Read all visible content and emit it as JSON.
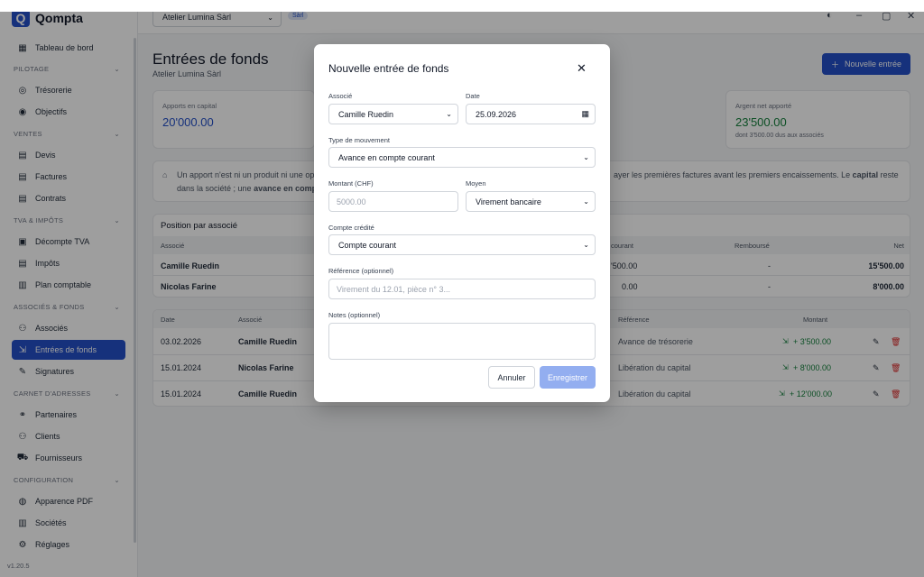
{
  "app": {
    "name": "Qompta",
    "version": "v1.20.5"
  },
  "sidebar": {
    "items": [
      {
        "label": "Tableau de bord",
        "icon": "dashboard-icon"
      },
      {
        "section": "PILOTAGE"
      },
      {
        "label": "Trésorerie",
        "icon": "coins-icon"
      },
      {
        "label": "Objectifs",
        "icon": "target-icon"
      },
      {
        "section": "VENTES"
      },
      {
        "label": "Devis",
        "icon": "document-icon"
      },
      {
        "label": "Factures",
        "icon": "invoice-icon"
      },
      {
        "label": "Contrats",
        "icon": "contract-icon"
      },
      {
        "section": "TVA & IMPÔTS"
      },
      {
        "label": "Décompte TVA",
        "icon": "tax-icon"
      },
      {
        "label": "Impôts",
        "icon": "receipt-icon"
      },
      {
        "label": "Plan comptable",
        "icon": "book-icon"
      },
      {
        "section": "ASSOCIÉS & FONDS"
      },
      {
        "label": "Associés",
        "icon": "users-icon"
      },
      {
        "label": "Entrées de fonds",
        "icon": "money-in-icon",
        "active": true
      },
      {
        "label": "Signatures",
        "icon": "pen-icon"
      },
      {
        "section": "CARNET D'ADRESSES"
      },
      {
        "label": "Partenaires",
        "icon": "handshake-icon"
      },
      {
        "label": "Clients",
        "icon": "user-icon"
      },
      {
        "label": "Fournisseurs",
        "icon": "truck-icon"
      },
      {
        "section": "CONFIGURATION"
      },
      {
        "label": "Apparence PDF",
        "icon": "palette-icon"
      },
      {
        "label": "Sociétés",
        "icon": "building-icon"
      },
      {
        "label": "Réglages",
        "icon": "gear-icon"
      }
    ]
  },
  "topbar": {
    "company": "Atelier Lumina Sàrl",
    "badge": "Sàrl"
  },
  "page": {
    "title": "Entrées de fonds",
    "subtitle": "Atelier Lumina Sàrl",
    "new_button": "Nouvelle entrée",
    "cards": [
      {
        "label": "Apports en capital",
        "value": "20'000.00"
      },
      {
        "label": "Argent net apporté",
        "value": "23'500.00",
        "sub": "dont 3'500.00 dus aux associés"
      }
    ],
    "info": {
      "left_line1": "Un apport n'est ni un produit ni une op",
      "left_line2_a": "dans la société ; une ",
      "left_line2_b": "avance en compt",
      "right_a": "ayer les premières factures avant les premiers encaissements. Le ",
      "right_b": "capital",
      "right_c": " reste"
    },
    "position": {
      "title": "Position par associé",
      "headers": {
        "associe": "Associé",
        "courant": "courant",
        "rembourse": "Remboursé",
        "net": "Net"
      },
      "rows": [
        {
          "name": "Camille Ruedin",
          "courant": "'500.00",
          "rembourse": "-",
          "net": "15'500.00"
        },
        {
          "name": "Nicolas Farine",
          "courant": "0.00",
          "rembourse": "-",
          "net": "8'000.00"
        }
      ]
    },
    "entries": {
      "headers": {
        "date": "Date",
        "associe": "Associé",
        "reference": "Référence",
        "montant": "Montant"
      },
      "rows": [
        {
          "date": "03.02.2026",
          "name": "Camille Ruedin",
          "reference": "Avance de trésorerie",
          "amount": "+ 3'500.00"
        },
        {
          "date": "15.01.2024",
          "name": "Nicolas Farine",
          "reference": "Libération du capital",
          "amount": "+ 8'000.00"
        },
        {
          "date": "15.01.2024",
          "name": "Camille Ruedin",
          "reference": "Libération du capital",
          "amount": "+ 12'000.00"
        }
      ]
    }
  },
  "modal": {
    "title": "Nouvelle entrée de fonds",
    "associe_label": "Associé",
    "associe_value": "Camille Ruedin",
    "date_label": "Date",
    "date_value": "25.09.2026",
    "type_label": "Type de mouvement",
    "type_value": "Avance en compte courant",
    "montant_label": "Montant (CHF)",
    "montant_placeholder": "5000.00",
    "moyen_label": "Moyen",
    "moyen_value": "Virement bancaire",
    "compte_label": "Compte crédité",
    "compte_value": "Compte courant",
    "reference_label": "Référence (optionnel)",
    "reference_placeholder": "Virement du 12.01, pièce n° 3...",
    "notes_label": "Notes (optionnel)",
    "cancel": "Annuler",
    "save": "Enregistrer"
  },
  "colors": {
    "accent": "#2450c8",
    "green": "#15803d",
    "red": "#dc2626"
  }
}
